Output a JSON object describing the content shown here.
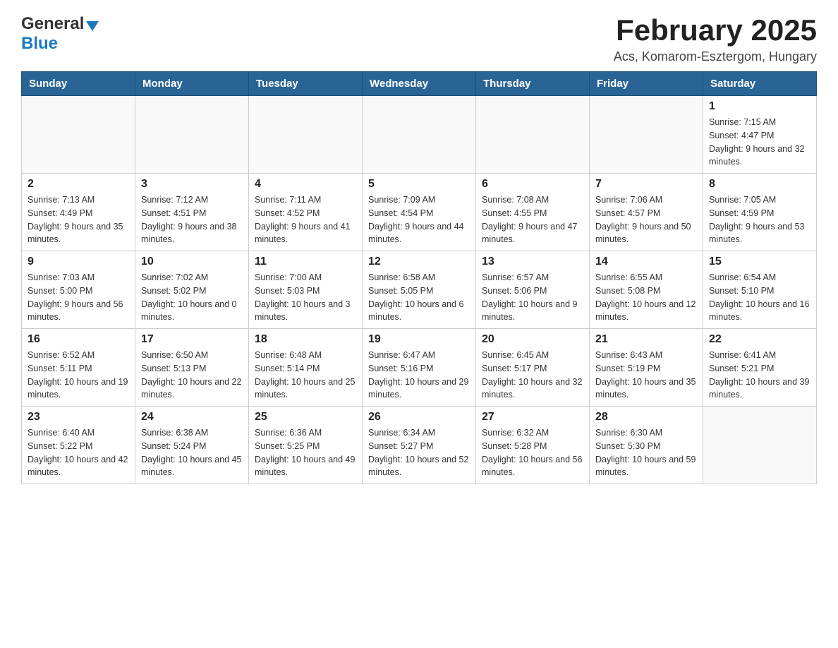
{
  "header": {
    "logo_general": "General",
    "logo_blue": "Blue",
    "title": "February 2025",
    "location": "Acs, Komarom-Esztergom, Hungary"
  },
  "weekdays": [
    "Sunday",
    "Monday",
    "Tuesday",
    "Wednesday",
    "Thursday",
    "Friday",
    "Saturday"
  ],
  "weeks": [
    {
      "days": [
        {
          "number": "",
          "info": ""
        },
        {
          "number": "",
          "info": ""
        },
        {
          "number": "",
          "info": ""
        },
        {
          "number": "",
          "info": ""
        },
        {
          "number": "",
          "info": ""
        },
        {
          "number": "",
          "info": ""
        },
        {
          "number": "1",
          "info": "Sunrise: 7:15 AM\nSunset: 4:47 PM\nDaylight: 9 hours and 32 minutes."
        }
      ]
    },
    {
      "days": [
        {
          "number": "2",
          "info": "Sunrise: 7:13 AM\nSunset: 4:49 PM\nDaylight: 9 hours and 35 minutes."
        },
        {
          "number": "3",
          "info": "Sunrise: 7:12 AM\nSunset: 4:51 PM\nDaylight: 9 hours and 38 minutes."
        },
        {
          "number": "4",
          "info": "Sunrise: 7:11 AM\nSunset: 4:52 PM\nDaylight: 9 hours and 41 minutes."
        },
        {
          "number": "5",
          "info": "Sunrise: 7:09 AM\nSunset: 4:54 PM\nDaylight: 9 hours and 44 minutes."
        },
        {
          "number": "6",
          "info": "Sunrise: 7:08 AM\nSunset: 4:55 PM\nDaylight: 9 hours and 47 minutes."
        },
        {
          "number": "7",
          "info": "Sunrise: 7:06 AM\nSunset: 4:57 PM\nDaylight: 9 hours and 50 minutes."
        },
        {
          "number": "8",
          "info": "Sunrise: 7:05 AM\nSunset: 4:59 PM\nDaylight: 9 hours and 53 minutes."
        }
      ]
    },
    {
      "days": [
        {
          "number": "9",
          "info": "Sunrise: 7:03 AM\nSunset: 5:00 PM\nDaylight: 9 hours and 56 minutes."
        },
        {
          "number": "10",
          "info": "Sunrise: 7:02 AM\nSunset: 5:02 PM\nDaylight: 10 hours and 0 minutes."
        },
        {
          "number": "11",
          "info": "Sunrise: 7:00 AM\nSunset: 5:03 PM\nDaylight: 10 hours and 3 minutes."
        },
        {
          "number": "12",
          "info": "Sunrise: 6:58 AM\nSunset: 5:05 PM\nDaylight: 10 hours and 6 minutes."
        },
        {
          "number": "13",
          "info": "Sunrise: 6:57 AM\nSunset: 5:06 PM\nDaylight: 10 hours and 9 minutes."
        },
        {
          "number": "14",
          "info": "Sunrise: 6:55 AM\nSunset: 5:08 PM\nDaylight: 10 hours and 12 minutes."
        },
        {
          "number": "15",
          "info": "Sunrise: 6:54 AM\nSunset: 5:10 PM\nDaylight: 10 hours and 16 minutes."
        }
      ]
    },
    {
      "days": [
        {
          "number": "16",
          "info": "Sunrise: 6:52 AM\nSunset: 5:11 PM\nDaylight: 10 hours and 19 minutes."
        },
        {
          "number": "17",
          "info": "Sunrise: 6:50 AM\nSunset: 5:13 PM\nDaylight: 10 hours and 22 minutes."
        },
        {
          "number": "18",
          "info": "Sunrise: 6:48 AM\nSunset: 5:14 PM\nDaylight: 10 hours and 25 minutes."
        },
        {
          "number": "19",
          "info": "Sunrise: 6:47 AM\nSunset: 5:16 PM\nDaylight: 10 hours and 29 minutes."
        },
        {
          "number": "20",
          "info": "Sunrise: 6:45 AM\nSunset: 5:17 PM\nDaylight: 10 hours and 32 minutes."
        },
        {
          "number": "21",
          "info": "Sunrise: 6:43 AM\nSunset: 5:19 PM\nDaylight: 10 hours and 35 minutes."
        },
        {
          "number": "22",
          "info": "Sunrise: 6:41 AM\nSunset: 5:21 PM\nDaylight: 10 hours and 39 minutes."
        }
      ]
    },
    {
      "days": [
        {
          "number": "23",
          "info": "Sunrise: 6:40 AM\nSunset: 5:22 PM\nDaylight: 10 hours and 42 minutes."
        },
        {
          "number": "24",
          "info": "Sunrise: 6:38 AM\nSunset: 5:24 PM\nDaylight: 10 hours and 45 minutes."
        },
        {
          "number": "25",
          "info": "Sunrise: 6:36 AM\nSunset: 5:25 PM\nDaylight: 10 hours and 49 minutes."
        },
        {
          "number": "26",
          "info": "Sunrise: 6:34 AM\nSunset: 5:27 PM\nDaylight: 10 hours and 52 minutes."
        },
        {
          "number": "27",
          "info": "Sunrise: 6:32 AM\nSunset: 5:28 PM\nDaylight: 10 hours and 56 minutes."
        },
        {
          "number": "28",
          "info": "Sunrise: 6:30 AM\nSunset: 5:30 PM\nDaylight: 10 hours and 59 minutes."
        },
        {
          "number": "",
          "info": ""
        }
      ]
    }
  ]
}
